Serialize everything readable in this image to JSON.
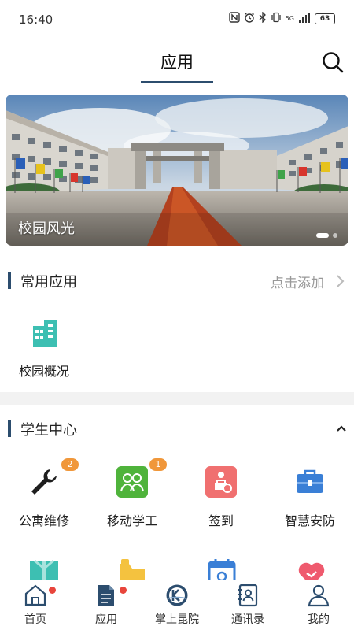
{
  "status_bar": {
    "time": "16:40",
    "icons": [
      "nfc-icon",
      "alarm-icon",
      "bluetooth-icon",
      "vibrate-icon",
      "signal-icon"
    ],
    "network": "5G",
    "battery": "63"
  },
  "header": {
    "title": "应用",
    "search_icon": "search-icon"
  },
  "banner": {
    "caption": "校园风光",
    "slide_count": 2,
    "active_slide": 1
  },
  "common_apps": {
    "title": "常用应用",
    "action": "点击添加",
    "items": [
      {
        "label": "校园概况",
        "icon": "building-icon",
        "color": "#3dbfb2"
      }
    ]
  },
  "student_center": {
    "title": "学生中心",
    "items": [
      {
        "label": "公寓维修",
        "icon": "wrench-icon",
        "badge": "2",
        "color": "#222222"
      },
      {
        "label": "移动学工",
        "icon": "students-icon",
        "badge": "1",
        "color": "#4fb33b"
      },
      {
        "label": "签到",
        "icon": "checkin-icon",
        "badge": "",
        "color": "#f07070"
      },
      {
        "label": "智慧安防",
        "icon": "toolbox-icon",
        "badge": "",
        "color": "#3a7fd6"
      }
    ],
    "partial_row_icons": [
      "gift-icon",
      "bed-icon",
      "calendar-icon",
      "heart-icon"
    ]
  },
  "bottom_nav": {
    "items": [
      {
        "label": "首页",
        "icon": "home-icon",
        "dot": true
      },
      {
        "label": "应用",
        "icon": "document-icon",
        "dot": true
      },
      {
        "label": "掌上昆院",
        "icon": "school-logo-icon",
        "dot": false
      },
      {
        "label": "通讯录",
        "icon": "contacts-icon",
        "dot": false
      },
      {
        "label": "我的",
        "icon": "profile-icon",
        "dot": false
      }
    ]
  },
  "colors": {
    "accent": "#2c4d6e",
    "badge": "#f0973a",
    "notification_dot": "#e8453c"
  }
}
